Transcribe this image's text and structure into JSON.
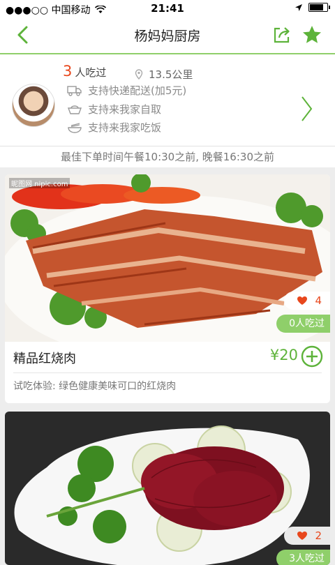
{
  "status_bar": {
    "carrier": "●●●○○ 中国移动",
    "time": "21:41",
    "battery_level": 0.85
  },
  "navbar": {
    "title": "杨妈妈厨房"
  },
  "store": {
    "eaten_count": "3",
    "eaten_text": "人吃过",
    "distance": "13.5公里",
    "services": [
      {
        "label": "支持快递配送(加5元)",
        "icon": "truck-icon"
      },
      {
        "label": "支持来我家自取",
        "icon": "basket-icon"
      },
      {
        "label": "支持来我家吃饭",
        "icon": "bowl-icon"
      }
    ]
  },
  "order_tip": "最佳下单时间午餐10:30之前, 晚餐16:30之前",
  "dishes": [
    {
      "name": "精品红烧肉",
      "price": "¥20",
      "likes": "4",
      "eaten": "0人吃过",
      "desc": "试吃体验: 绿色健康美味可口的红烧肉",
      "watermark": "昵图网 nipic.com"
    },
    {
      "likes": "2",
      "eaten": "3人吃过"
    }
  ],
  "colors": {
    "accent_green": "#5db33a",
    "light_green": "#8fcf6a",
    "highlight_red": "#e8471c"
  }
}
